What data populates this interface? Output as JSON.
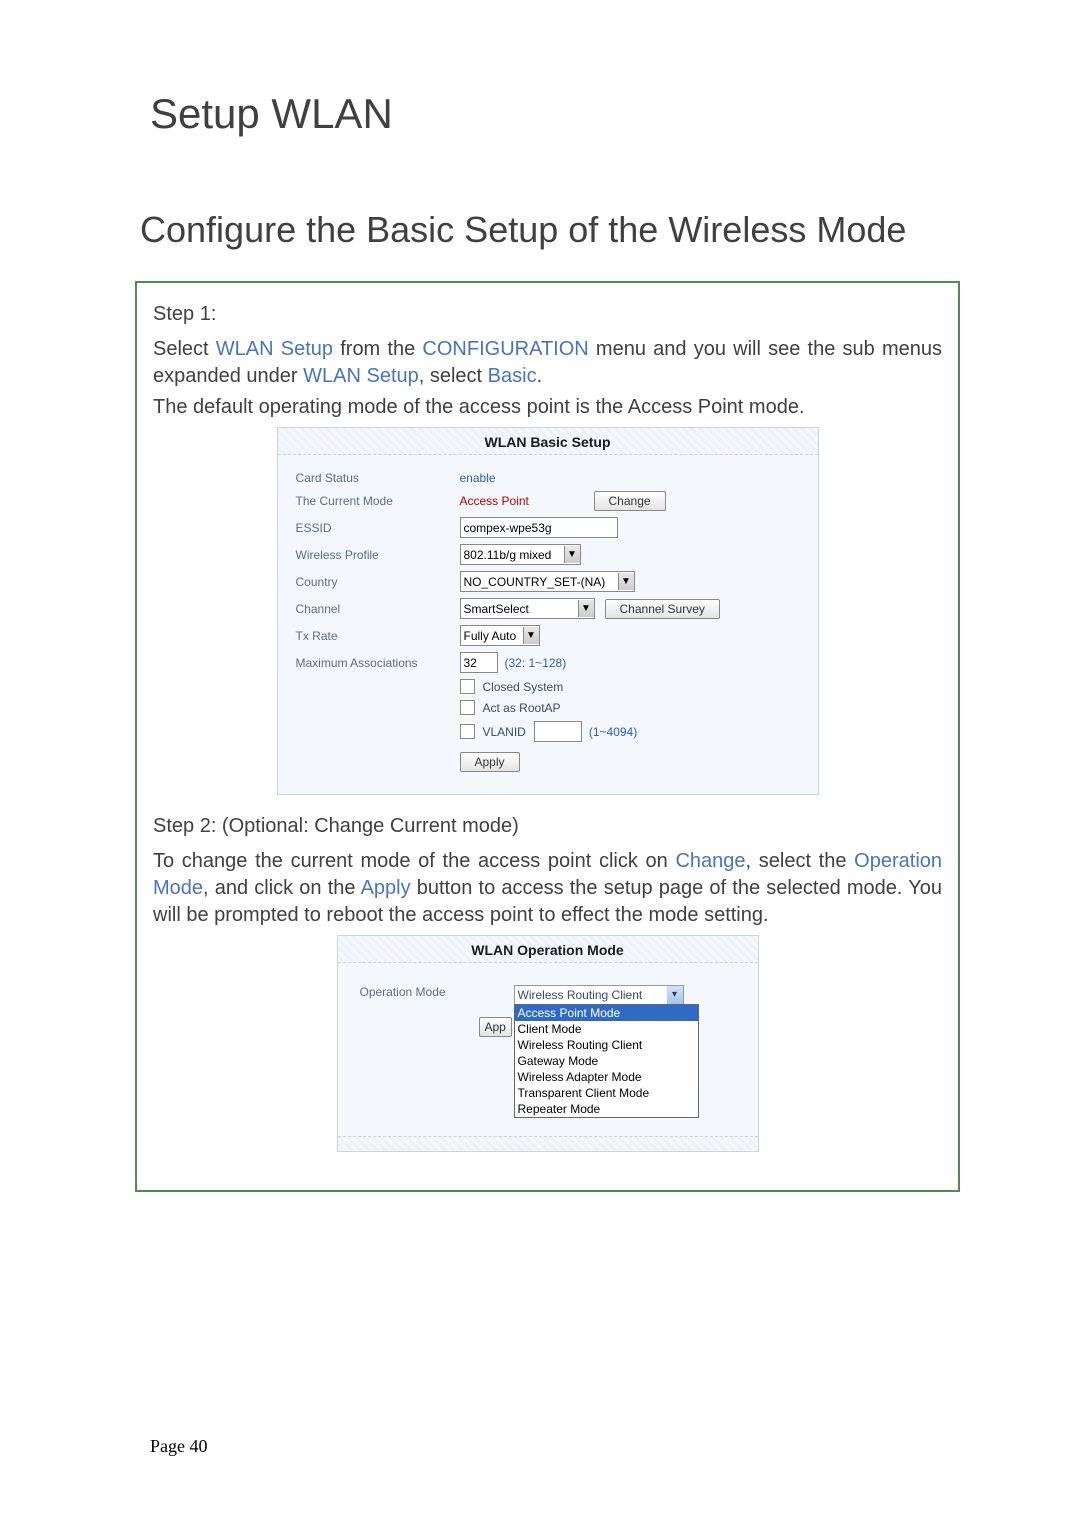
{
  "title": "Setup WLAN",
  "subtitle": "Configure the Basic Setup of the Wireless Mode",
  "step1": {
    "heading": "Step 1:",
    "text_parts": {
      "p1a": "Select ",
      "p1b": "WLAN Setup",
      "p1c": " from the ",
      "p1d": "CONFIGURATION",
      "p1e": " menu and you will see the sub menus expanded under ",
      "p1f": "WLAN Setup",
      "p1g": ", select ",
      "p1h": "Basic",
      "p1i": "."
    },
    "line2": "The default operating mode of the access point is the Access Point mode."
  },
  "wlan_setup": {
    "title": "WLAN Basic Setup",
    "card_status_label": "Card Status",
    "card_status_value": "enable",
    "mode_label": "The Current Mode",
    "mode_value": "Access Point",
    "change_btn": "Change",
    "essid_label": "ESSID",
    "essid_value": "compex-wpe53g",
    "profile_label": "Wireless Profile",
    "profile_value": "802.11b/g mixed",
    "country_label": "Country",
    "country_value": "NO_COUNTRY_SET-(NA)",
    "channel_label": "Channel",
    "channel_value": "SmartSelect",
    "survey_btn": "Channel Survey",
    "txrate_label": "Tx Rate",
    "txrate_value": "Fully Auto",
    "maxassoc_label": "Maximum Associations",
    "maxassoc_value": "32",
    "maxassoc_hint": "(32: 1~128)",
    "closed_label": "Closed System",
    "rootap_label": "Act as RootAP",
    "vlanid_label": "VLANID",
    "vlanid_hint": "(1~4094)",
    "apply_btn": "Apply"
  },
  "step2": {
    "heading": "Step 2: (Optional: Change Current mode)",
    "text_parts": {
      "a": "To change the current mode of the access point click on ",
      "b": "Change",
      "c": ", select the ",
      "d": "Operation Mode",
      "e": ", and click on the ",
      "f": "Apply",
      "g": " button to access the setup page of the selected mode. You will be prompted to reboot the access point to effect the mode setting."
    }
  },
  "op_mode": {
    "title": "WLAN Operation Mode",
    "label": "Operation Mode",
    "selected": "Wireless Routing Client",
    "app_btn": "App",
    "options": [
      "Access Point Mode",
      "Client Mode",
      "Wireless Routing Client",
      "Gateway Mode",
      "Wireless Adapter Mode",
      "Transparent Client Mode",
      "Repeater Mode"
    ]
  },
  "footer": "Page 40"
}
